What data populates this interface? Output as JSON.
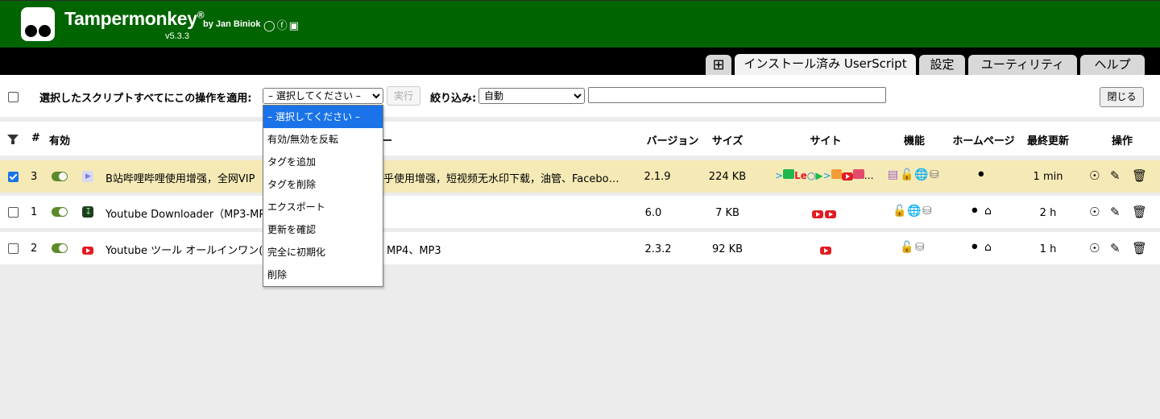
{
  "header": {
    "app_name": "Tampermonkey",
    "reg_mark": "®",
    "by_label": "by Jan Biniok",
    "version": "v5.3.3",
    "social_icons": "github-icon facebook-icon instagram-icon",
    "bg_color": "#006400"
  },
  "tabs": [
    {
      "label": "⊞",
      "name": "new-script"
    },
    {
      "label": "インストール済み UserScript",
      "name": "installed",
      "active": true
    },
    {
      "label": "設定",
      "name": "settings"
    },
    {
      "label": "ユーティリティ",
      "name": "utilities"
    },
    {
      "label": "ヘルプ",
      "name": "help"
    }
  ],
  "toolbar": {
    "apply_label": "選択したスクリプトすべてにこの操作を適用:",
    "action_select_value": "– 選択してください –",
    "run_label": "実行",
    "filter_label": "絞り込み:",
    "filter_select_value": "自動",
    "filter_input_value": "",
    "close_label": "閉じる"
  },
  "dropdown": {
    "options": [
      "– 選択してください –",
      "有効/無効を反転",
      "タグを追加",
      "タグを削除",
      "エクスポート",
      "更新を確認",
      "完全に初期化",
      "削除"
    ],
    "highlighted_index": 0
  },
  "columns": {
    "num": "#",
    "enabled": "有効",
    "name_tail": "ー",
    "version": "バージョン",
    "size": "サイズ",
    "sites": "サイト",
    "features": "機能",
    "homepage": "ホームページ",
    "updated": "最終更新",
    "actions": "操作"
  },
  "scripts": [
    {
      "checked": true,
      "num": "3",
      "enabled": true,
      "name": "B站哔哩哔哩使用增强，全网VIP",
      "name_tail": "乎使用增强，短视频无水印下载，油管、Facebo…",
      "version": "2.1.9",
      "size": "224 KB",
      "sites_more": "…",
      "updated": "1 min"
    },
    {
      "checked": false,
      "num": "1",
      "enabled": true,
      "name": "Youtube Downloader（MP3-MP4",
      "name_tail": "",
      "version": "6.0",
      "size": "7 KB",
      "updated": "2 h"
    },
    {
      "checked": false,
      "num": "2",
      "enabled": true,
      "name": "Youtube ツール オールインワン(",
      "name_tail": "MP4、MP3",
      "version": "2.3.2",
      "size": "92 KB",
      "updated": "1 h"
    }
  ],
  "colors": {
    "accent": "#1a73e8",
    "selected_row": "#f5eab6",
    "toggle_on": "#5d8a2a",
    "youtube_red": "#e31b23"
  }
}
